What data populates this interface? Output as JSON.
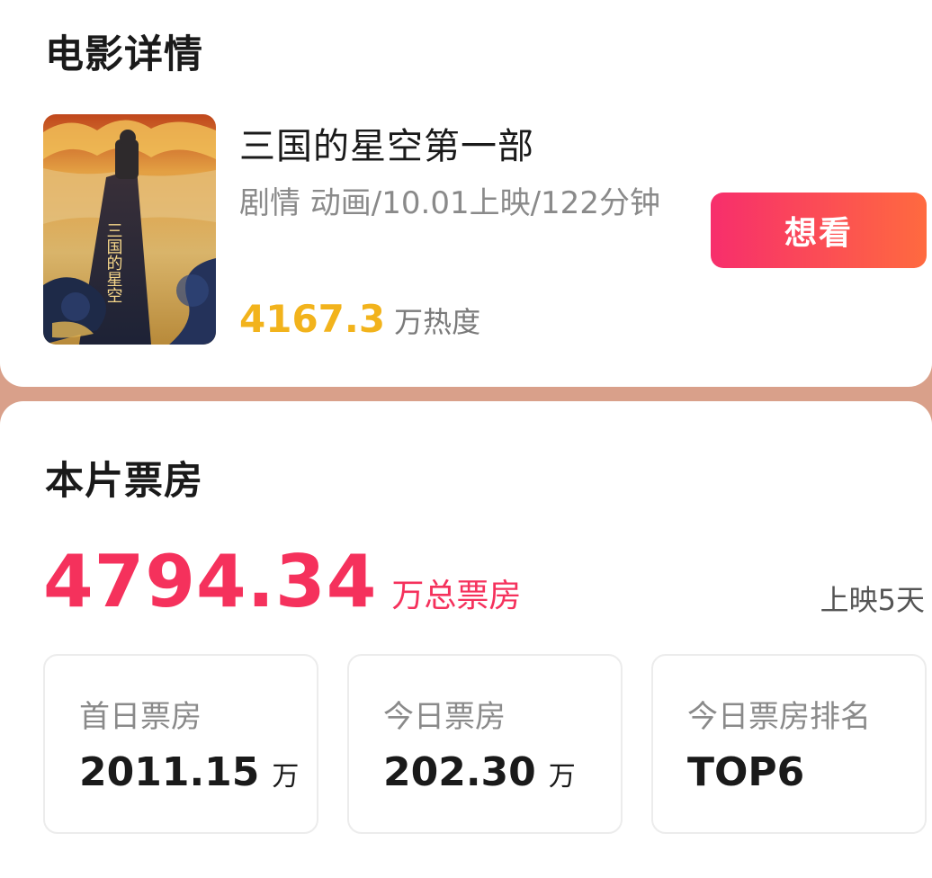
{
  "details": {
    "section_title": "电影详情",
    "movie_title": "三国的星空第一部",
    "meta": "剧情 动画/10.01上映/122分钟",
    "heat_value": "4167.3",
    "heat_unit": "万热度",
    "want_label": "想看",
    "poster_text": "三国的星空"
  },
  "boxoffice": {
    "section_title": "本片票房",
    "total_value": "4794.34",
    "total_unit": "万总票房",
    "days_label": "上映5天",
    "stats": [
      {
        "label": "首日票房",
        "value": "2011.15",
        "unit": "万"
      },
      {
        "label": "今日票房",
        "value": "202.30",
        "unit": "万"
      },
      {
        "label": "今日票房排名",
        "value": "TOP6",
        "unit": ""
      }
    ]
  },
  "colors": {
    "accent_red": "#f5315c",
    "heat_yellow": "#f2b31c",
    "button_gradient_start": "#f72e6c",
    "button_gradient_end": "#ff6a3f"
  }
}
